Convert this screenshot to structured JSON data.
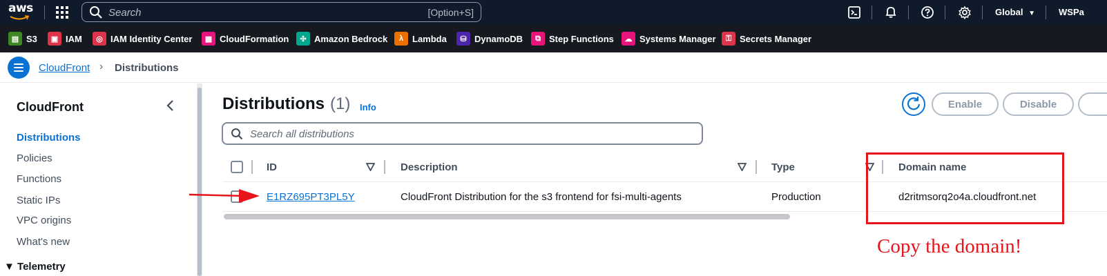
{
  "topnav": {
    "logo_text": "aws",
    "search_placeholder": "Search",
    "search_shortcut": "[Option+S]",
    "region": "Global",
    "account": "WSPa",
    "icons": [
      "cloudshell-icon",
      "bell-icon",
      "help-icon",
      "gear-icon"
    ]
  },
  "favorites": [
    {
      "label": "S3",
      "icon": "s3-icon",
      "color": "#3f8624"
    },
    {
      "label": "IAM",
      "icon": "iam-icon",
      "color": "#dd344c"
    },
    {
      "label": "IAM Identity Center",
      "icon": "identity-center-icon",
      "color": "#dd344c"
    },
    {
      "label": "CloudFormation",
      "icon": "cloudformation-icon",
      "color": "#e7157b"
    },
    {
      "label": "Amazon Bedrock",
      "icon": "bedrock-icon",
      "color": "#01a88d"
    },
    {
      "label": "Lambda",
      "icon": "lambda-icon",
      "color": "#ed7100"
    },
    {
      "label": "DynamoDB",
      "icon": "dynamodb-icon",
      "color": "#4d27aa"
    },
    {
      "label": "Step Functions",
      "icon": "step-functions-icon",
      "color": "#e7157b"
    },
    {
      "label": "Systems Manager",
      "icon": "systems-manager-icon",
      "color": "#e7157b"
    },
    {
      "label": "Secrets Manager",
      "icon": "secrets-manager-icon",
      "color": "#dd344c"
    }
  ],
  "breadcrumb": {
    "parent": "CloudFront",
    "current": "Distributions"
  },
  "sidebar": {
    "title": "CloudFront",
    "items": [
      {
        "label": "Distributions",
        "active": true
      },
      {
        "label": "Policies",
        "active": false
      },
      {
        "label": "Functions",
        "active": false
      },
      {
        "label": "Static IPs",
        "active": false
      },
      {
        "label": "VPC origins",
        "active": false
      },
      {
        "label": "What's new",
        "active": false
      }
    ],
    "section": "▼ Telemetry"
  },
  "main": {
    "title": "Distributions",
    "count": "(1)",
    "info": "Info",
    "enable_label": "Enable",
    "disable_label": "Disable",
    "search_placeholder": "Search all distributions",
    "columns": [
      "ID",
      "Description",
      "Type",
      "Domain name"
    ],
    "rows": [
      {
        "id": "E1RZ695PT3PL5Y",
        "description": "CloudFront Distribution for the s3 frontend for fsi-multi-agents",
        "type": "Production",
        "domain": "d2ritmsorq2o4a.cloudfront.net"
      }
    ]
  },
  "annotation": {
    "text": "Copy the domain!",
    "color": "#e8141c"
  },
  "colors": {
    "nav_bg": "#0f1b2a",
    "fav_bg": "#16191f",
    "link": "#0972d3"
  }
}
